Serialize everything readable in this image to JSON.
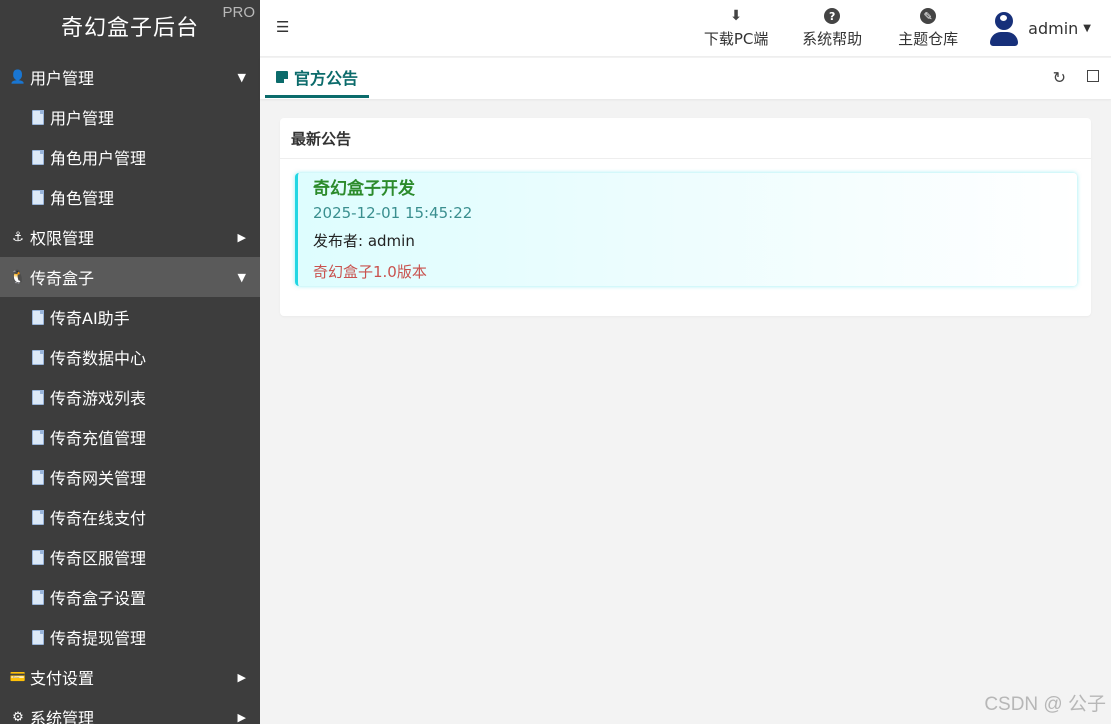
{
  "brand": {
    "title": "奇幻盒子后台",
    "badge": "PRO"
  },
  "sidebar": {
    "groups": [
      {
        "label": "用户管理",
        "icon": "user-icon",
        "expanded": true,
        "items": [
          {
            "label": "用户管理"
          },
          {
            "label": "角色用户管理"
          },
          {
            "label": "角色管理"
          }
        ]
      },
      {
        "label": "权限管理",
        "icon": "anchor-icon",
        "expanded": false
      },
      {
        "label": "传奇盒子",
        "icon": "penguin-icon",
        "expanded": true,
        "active": true,
        "items": [
          {
            "label": "传奇AI助手"
          },
          {
            "label": "传奇数据中心"
          },
          {
            "label": "传奇游戏列表"
          },
          {
            "label": "传奇充值管理"
          },
          {
            "label": "传奇网关管理"
          },
          {
            "label": "传奇在线支付"
          },
          {
            "label": "传奇区服管理"
          },
          {
            "label": "传奇盒子设置"
          },
          {
            "label": "传奇提现管理"
          }
        ]
      },
      {
        "label": "支付设置",
        "icon": "payment-icon",
        "expanded": false
      },
      {
        "label": "系统管理",
        "icon": "gear-icon",
        "expanded": false
      }
    ]
  },
  "header": {
    "tools": [
      {
        "label": "下载PC端",
        "icon": "download-icon"
      },
      {
        "label": "系统帮助",
        "icon": "help-icon"
      },
      {
        "label": "主题仓库",
        "icon": "theme-icon"
      }
    ],
    "user": {
      "name": "admin"
    }
  },
  "tabs": [
    {
      "label": "官方公告",
      "active": true
    }
  ],
  "card": {
    "title": "最新公告",
    "notice": {
      "title": "奇幻盒子开发",
      "date": "2025-12-01 15:45:22",
      "author": "发布者: admin",
      "content": "奇幻盒子1.0版本"
    }
  },
  "watermark": "CSDN @ 公子",
  "colors": {
    "sidebar_bg": "#3d3d3d",
    "accent": "#0b6b6b",
    "notice_border": "#22d6e3",
    "notice_title": "#2c8b2c",
    "notice_content": "#c9524e"
  }
}
